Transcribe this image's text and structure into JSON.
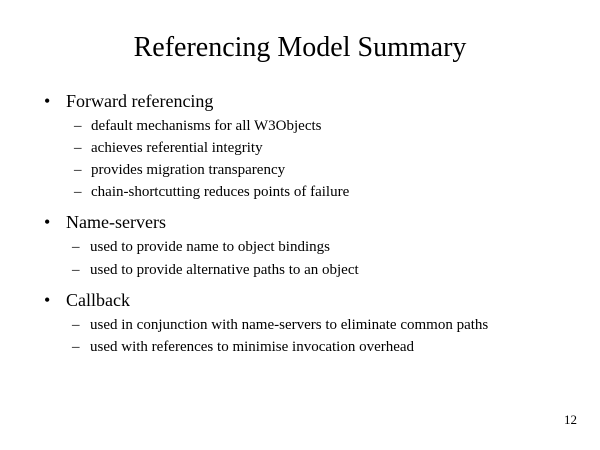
{
  "slide": {
    "title": "Referencing Model Summary",
    "bullet_glyph": "•",
    "dash_glyph": "–",
    "sections": [
      {
        "heading": "Forward referencing",
        "items": [
          "default mechanisms for all W3Objects",
          "achieves referential integrity",
          "provides migration transparency",
          "chain-shortcutting reduces points of failure"
        ]
      },
      {
        "heading": "Name-servers",
        "items": [
          "used to provide name to object bindings",
          "used to provide alternative paths to an object"
        ]
      },
      {
        "heading": "Callback",
        "items": [
          "used in conjunction with name-servers to eliminate common paths",
          "used with references to minimise invocation overhead"
        ]
      }
    ],
    "page_number": "12"
  }
}
